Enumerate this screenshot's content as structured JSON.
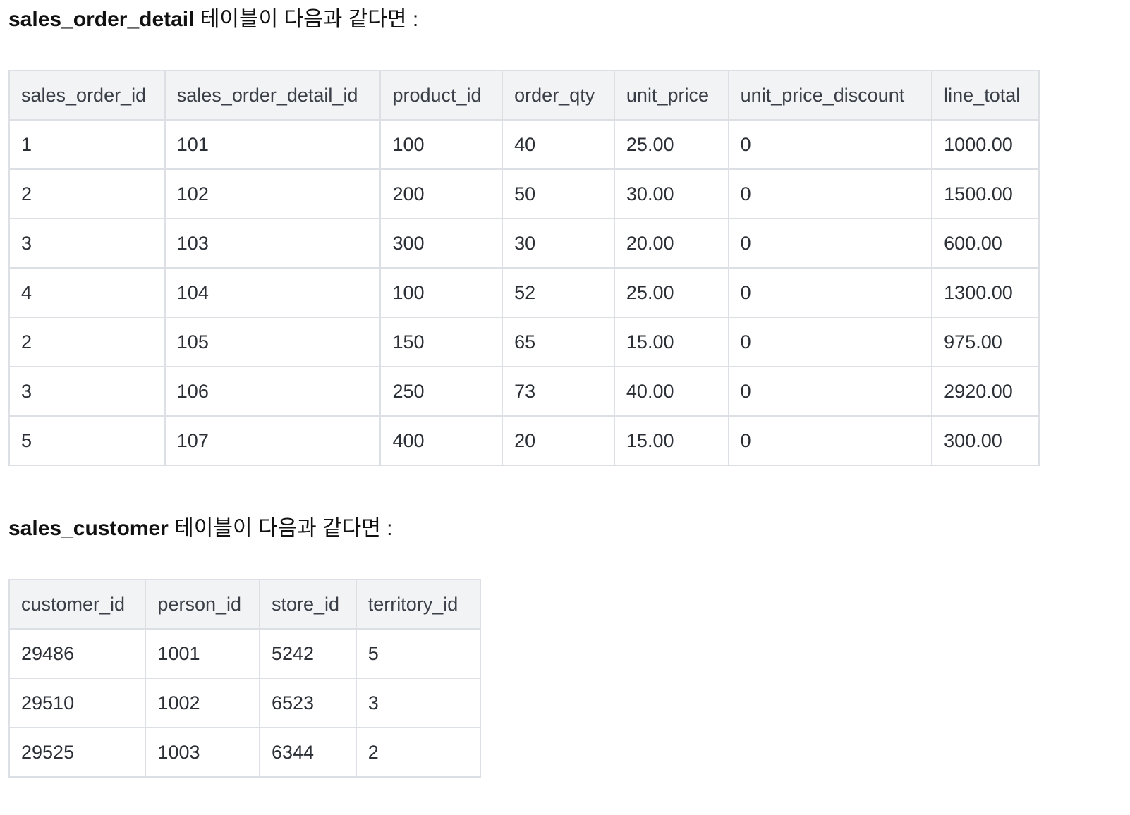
{
  "section1": {
    "table_name": "sales_order_detail",
    "caption_suffix": " 테이블이 다음과 같다면 :",
    "columns": [
      "sales_order_id",
      "sales_order_detail_id",
      "product_id",
      "order_qty",
      "unit_price",
      "unit_price_discount",
      "line_total"
    ],
    "rows": [
      [
        "1",
        "101",
        "100",
        "40",
        "25.00",
        "0",
        "1000.00"
      ],
      [
        "2",
        "102",
        "200",
        "50",
        "30.00",
        "0",
        "1500.00"
      ],
      [
        "3",
        "103",
        "300",
        "30",
        "20.00",
        "0",
        "600.00"
      ],
      [
        "4",
        "104",
        "100",
        "52",
        "25.00",
        "0",
        "1300.00"
      ],
      [
        "2",
        "105",
        "150",
        "65",
        "15.00",
        "0",
        "975.00"
      ],
      [
        "3",
        "106",
        "250",
        "73",
        "40.00",
        "0",
        "2920.00"
      ],
      [
        "5",
        "107",
        "400",
        "20",
        "15.00",
        "0",
        "300.00"
      ]
    ]
  },
  "section2": {
    "table_name": "sales_customer",
    "caption_suffix": " 테이블이 다음과 같다면 :",
    "columns": [
      "customer_id",
      "person_id",
      "store_id",
      "territory_id"
    ],
    "rows": [
      [
        "29486",
        "1001",
        "5242",
        "5"
      ],
      [
        "29510",
        "1002",
        "6523",
        "3"
      ],
      [
        "29525",
        "1003",
        "6344",
        "2"
      ]
    ]
  }
}
